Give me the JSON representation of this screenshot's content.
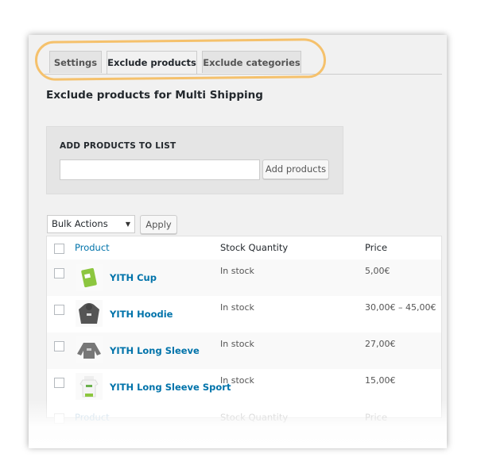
{
  "tabs": [
    {
      "label": "Settings",
      "active": false
    },
    {
      "label": "Exclude products",
      "active": true
    },
    {
      "label": "Exclude categories",
      "active": false
    }
  ],
  "page_title": "Exclude products for Multi Shipping",
  "add_box": {
    "label": "ADD PRODUCTS TO LIST",
    "input_value": "",
    "button_label": "Add products"
  },
  "bulk": {
    "selected": "Bulk Actions",
    "apply_label": "Apply"
  },
  "table": {
    "headers": {
      "product": "Product",
      "stock": "Stock Quantity",
      "price": "Price"
    },
    "rows": [
      {
        "name": "YITH Cup",
        "stock": "In stock",
        "price": "5,00€",
        "thumb_icon": "cup-icon"
      },
      {
        "name": "YITH Hoodie",
        "stock": "In stock",
        "price": "30,00€ – 45,00€",
        "thumb_icon": "hoodie-icon"
      },
      {
        "name": "YITH Long Sleeve",
        "stock": "In stock",
        "price": "27,00€",
        "thumb_icon": "long-sleeve-icon"
      },
      {
        "name": "YITH Long Sleeve Sport",
        "stock": "In stock",
        "price": "15,00€",
        "thumb_icon": "tshirt-icon"
      }
    ]
  },
  "colors": {
    "link": "#0073aa",
    "highlight": "#f5c16c",
    "panel": "#f1f1f1"
  }
}
